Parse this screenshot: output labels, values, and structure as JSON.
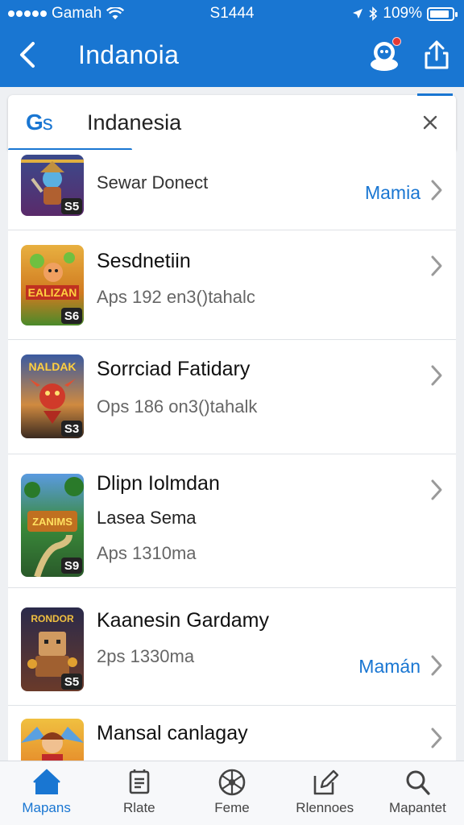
{
  "status_bar": {
    "carrier": "Gamah",
    "time": "S1444",
    "battery": "109%",
    "battery_level": 0.9
  },
  "header": {
    "title": "Indanoia"
  },
  "search": {
    "logo_g": "G",
    "logo_s": "s",
    "value": "Indanesia"
  },
  "accent_color": "#1976d2",
  "rows": [
    {
      "title": "Sewar Donect",
      "action": "Mamia",
      "badge": "S5",
      "icon": "warrior-game-icon"
    },
    {
      "title": "Sesdnetiin",
      "sub1": "Aps 192 en3()tahalc",
      "badge": "S6",
      "icon": "adventure-game-icon",
      "art": "EALIZAN"
    },
    {
      "title": "Sorrciad Fatidary",
      "sub1": "Ops 186 on3()tahalk",
      "badge": "S3",
      "icon": "dragon-game-icon",
      "art": "NALDAK"
    },
    {
      "title": "Dlipn Iolmdan",
      "sub1": "Lasea Sema",
      "sub2": "Aps 1310ma",
      "badge": "S9",
      "icon": "animals-game-icon",
      "art": "ZANIMS"
    },
    {
      "title": "Kaanesin Gardamy",
      "sub1": "2ps 1330ma",
      "action": "Mamán",
      "badge": "S5",
      "icon": "block-hero-game-icon",
      "art": "RONDOR"
    },
    {
      "title": "Mansal canlagay",
      "icon": "hero-girl-game-icon"
    }
  ],
  "bottom_nav": [
    {
      "label": "Mapans",
      "icon": "home-icon",
      "active": true
    },
    {
      "label": "Rlate",
      "icon": "document-icon",
      "active": false
    },
    {
      "label": "Feme",
      "icon": "games-wheel-icon",
      "active": false
    },
    {
      "label": "Rlennoes",
      "icon": "edit-icon",
      "active": false
    },
    {
      "label": "Mapantet",
      "icon": "search-icon",
      "active": false
    }
  ]
}
